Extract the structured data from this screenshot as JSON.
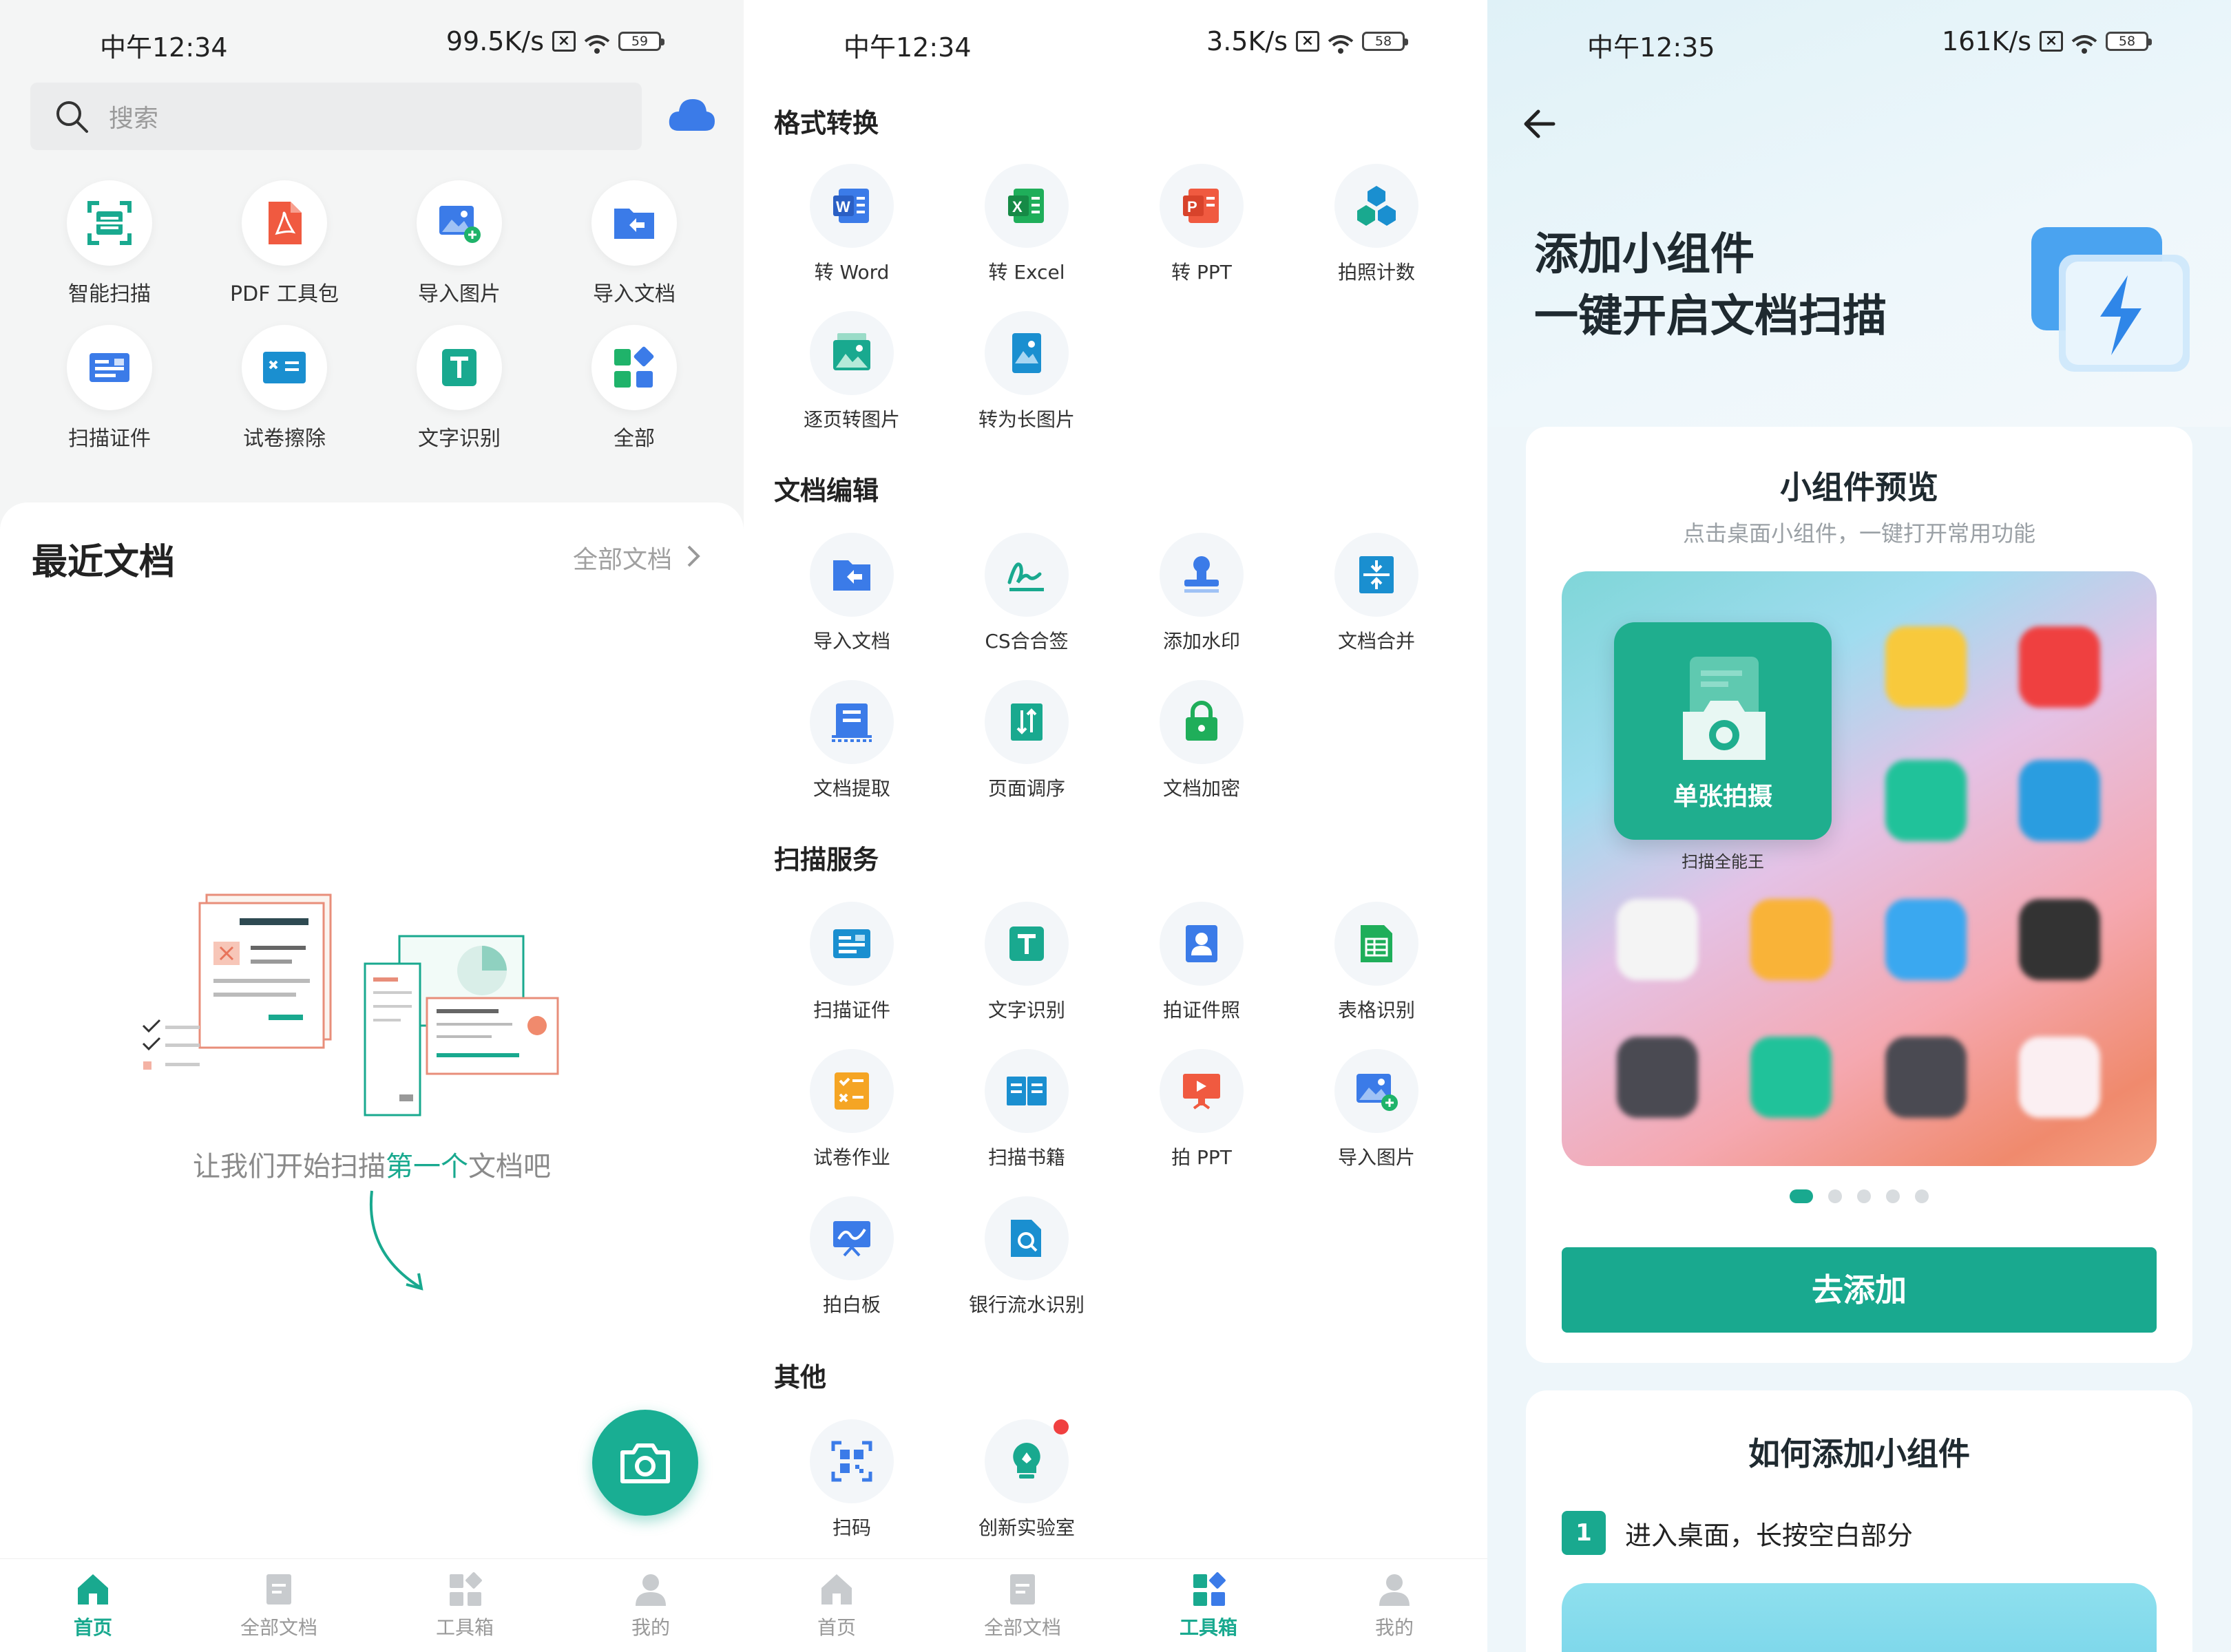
{
  "panel1": {
    "status": {
      "time": "中午12:34",
      "speed": "99.5K/s",
      "battery": "59"
    },
    "search": {
      "placeholder": "搜索"
    },
    "tools": [
      {
        "label": "智能扫描",
        "icon": "smart-scan-icon"
      },
      {
        "label": "PDF 工具包",
        "icon": "pdf-toolkit-icon"
      },
      {
        "label": "导入图片",
        "icon": "import-image-icon"
      },
      {
        "label": "导入文档",
        "icon": "import-doc-icon"
      },
      {
        "label": "扫描证件",
        "icon": "scan-id-icon"
      },
      {
        "label": "试卷擦除",
        "icon": "exam-erase-icon"
      },
      {
        "label": "文字识别",
        "icon": "text-recognition-icon"
      },
      {
        "label": "全部",
        "icon": "all-tools-icon"
      }
    ],
    "recent": {
      "title": "最近文档",
      "all_label": "全部文档"
    },
    "empty": {
      "prefix": "让我们开始扫描",
      "highlight": "第一个",
      "suffix": "文档吧"
    },
    "tabs": [
      {
        "label": "首页",
        "icon": "home-icon",
        "active": true
      },
      {
        "label": "全部文档",
        "icon": "documents-icon",
        "active": false
      },
      {
        "label": "工具箱",
        "icon": "toolbox-icon",
        "active": false
      },
      {
        "label": "我的",
        "icon": "profile-icon",
        "active": false
      }
    ]
  },
  "panel2": {
    "status": {
      "time": "中午12:34",
      "speed": "3.5K/s",
      "battery": "58"
    },
    "sections": [
      {
        "title": "格式转换",
        "items": [
          {
            "label": "转 Word",
            "icon": "word-icon"
          },
          {
            "label": "转 Excel",
            "icon": "excel-icon"
          },
          {
            "label": "转 PPT",
            "icon": "ppt-icon"
          },
          {
            "label": "拍照计数",
            "icon": "photo-count-icon"
          },
          {
            "label": "逐页转图片",
            "icon": "page-to-image-icon"
          },
          {
            "label": "转为长图片",
            "icon": "long-image-icon"
          }
        ]
      },
      {
        "title": "文档编辑",
        "items": [
          {
            "label": "导入文档",
            "icon": "import-doc-icon"
          },
          {
            "label": "CS合合签",
            "icon": "signature-icon"
          },
          {
            "label": "添加水印",
            "icon": "watermark-icon"
          },
          {
            "label": "文档合并",
            "icon": "merge-icon"
          },
          {
            "label": "文档提取",
            "icon": "extract-icon"
          },
          {
            "label": "页面调序",
            "icon": "reorder-icon"
          },
          {
            "label": "文档加密",
            "icon": "lock-icon"
          }
        ]
      },
      {
        "title": "扫描服务",
        "items": [
          {
            "label": "扫描证件",
            "icon": "scan-id-icon"
          },
          {
            "label": "文字识别",
            "icon": "text-recognition-icon"
          },
          {
            "label": "拍证件照",
            "icon": "id-photo-icon"
          },
          {
            "label": "表格识别",
            "icon": "table-recognition-icon"
          },
          {
            "label": "试卷作业",
            "icon": "exam-icon"
          },
          {
            "label": "扫描书籍",
            "icon": "book-icon"
          },
          {
            "label": "拍 PPT",
            "icon": "presentation-icon"
          },
          {
            "label": "导入图片",
            "icon": "import-image-icon"
          },
          {
            "label": "拍白板",
            "icon": "whiteboard-icon"
          },
          {
            "label": "银行流水识别",
            "icon": "bank-statement-icon"
          }
        ]
      },
      {
        "title": "其他",
        "items": [
          {
            "label": "扫码",
            "icon": "qr-scan-icon"
          },
          {
            "label": "创新实验室",
            "icon": "lab-icon"
          }
        ]
      }
    ],
    "tabs": [
      {
        "label": "首页",
        "icon": "home-icon",
        "active": false
      },
      {
        "label": "全部文档",
        "icon": "documents-icon",
        "active": false
      },
      {
        "label": "工具箱",
        "icon": "toolbox-icon",
        "active": true
      },
      {
        "label": "我的",
        "icon": "profile-icon",
        "active": false
      }
    ]
  },
  "panel3": {
    "status": {
      "time": "中午12:35",
      "speed": "161K/s",
      "battery": "58"
    },
    "hero": {
      "line1": "添加小组件",
      "line2": "一键开启文档扫描"
    },
    "preview": {
      "title": "小组件预览",
      "subtitle": "点击桌面小组件，一键打开常用功能",
      "widget_label": "单张拍摄",
      "widget_caption": "扫描全能王"
    },
    "add_button": "去添加",
    "howto": {
      "title": "如何添加小组件",
      "step_num": "1",
      "step_text": "进入桌面，长按空白部分"
    }
  },
  "colors": {
    "accent": "#19a98f",
    "blue": "#3b7be8",
    "red": "#f05a40"
  }
}
